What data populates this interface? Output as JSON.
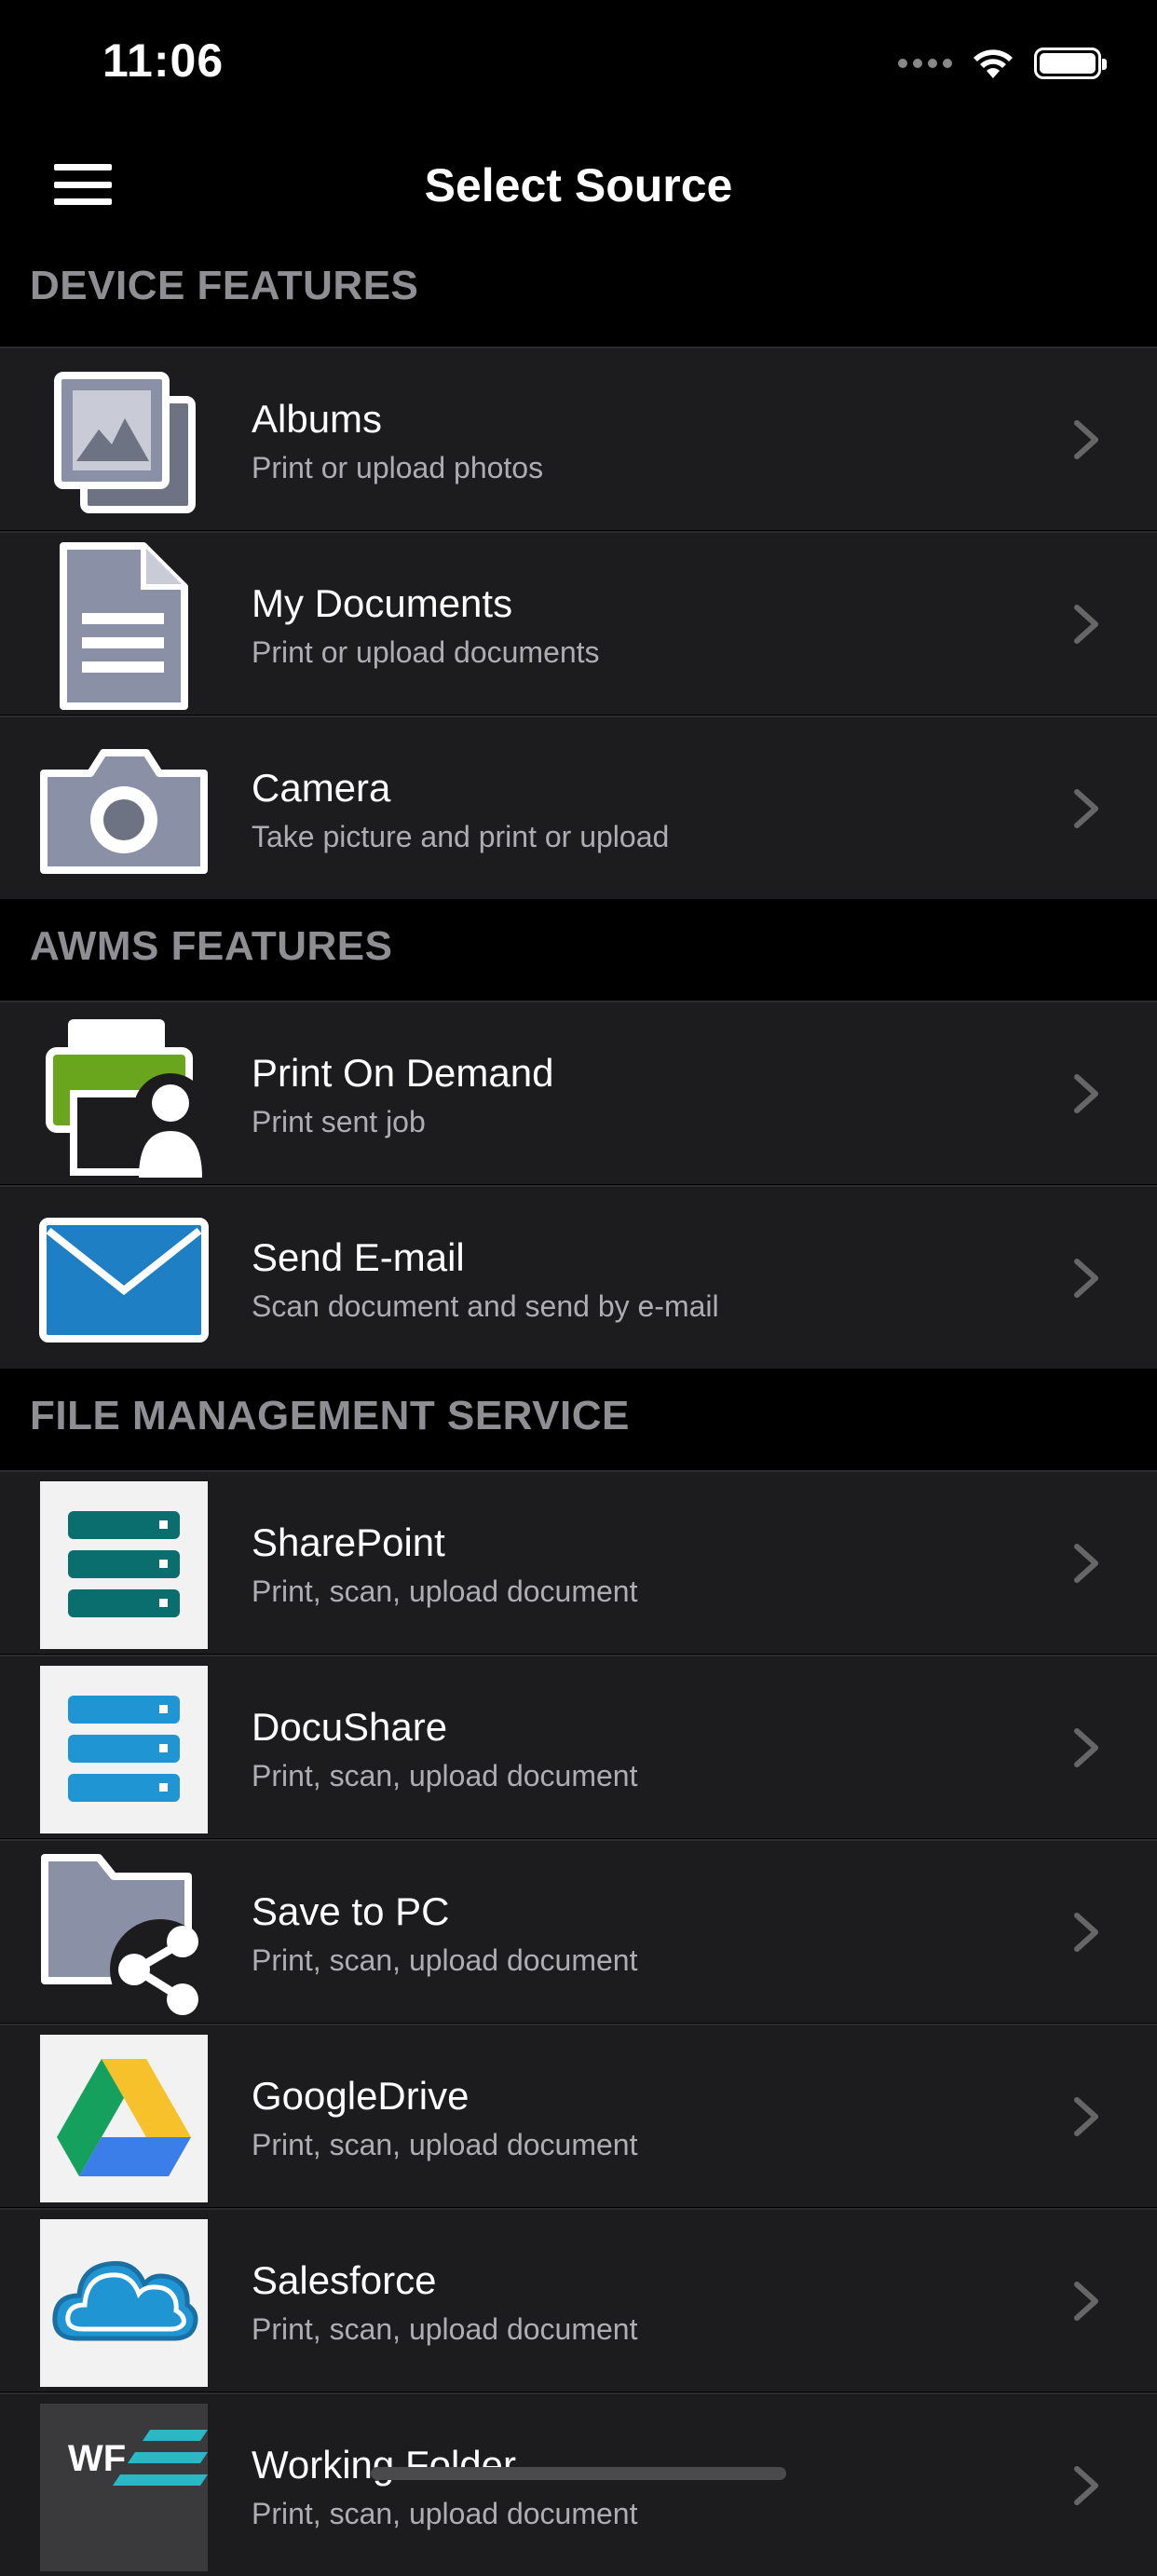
{
  "status": {
    "time": "11:06"
  },
  "nav": {
    "title": "Select Source"
  },
  "sections": {
    "device": "DEVICE FEATURES",
    "awms": "AWMS FEATURES",
    "fms": "FILE MANAGEMENT SERVICE"
  },
  "items": {
    "albums": {
      "title": "Albums",
      "subtitle": "Print or upload photos",
      "icon": "photo-albums-icon"
    },
    "documents": {
      "title": "My Documents",
      "subtitle": "Print or upload documents",
      "icon": "document-icon"
    },
    "camera": {
      "title": "Camera",
      "subtitle": "Take picture and print or upload",
      "icon": "camera-icon"
    },
    "print_on_demand": {
      "title": "Print On Demand",
      "subtitle": "Print sent job",
      "icon": "printer-user-icon"
    },
    "send_email": {
      "title": "Send E-mail",
      "subtitle": "Scan document and send by e-mail",
      "icon": "envelope-icon"
    },
    "sharepoint": {
      "title": "SharePoint",
      "subtitle": "Print, scan, upload document",
      "icon": "server-teal-icon"
    },
    "docushare": {
      "title": "DocuShare",
      "subtitle": "Print, scan, upload document",
      "icon": "server-blue-icon"
    },
    "save_to_pc": {
      "title": "Save to PC",
      "subtitle": "Print, scan, upload document",
      "icon": "folder-share-icon"
    },
    "googledrive": {
      "title": "GoogleDrive",
      "subtitle": "Print, scan, upload document",
      "icon": "google-drive-icon"
    },
    "salesforce": {
      "title": "Salesforce",
      "subtitle": "Print, scan, upload document",
      "icon": "cloud-icon"
    },
    "working_folder": {
      "title": "Working Folder",
      "subtitle": "Print, scan, upload document",
      "icon": "working-folder-icon",
      "badge": "WF"
    }
  },
  "colors": {
    "background": "#000000",
    "row": "#1c1c1e",
    "section_text": "#8e8e93",
    "subtitle": "#aeaeb2",
    "teal": "#0b6e6e",
    "blue": "#1f95d3",
    "green": "#6aa61d"
  }
}
